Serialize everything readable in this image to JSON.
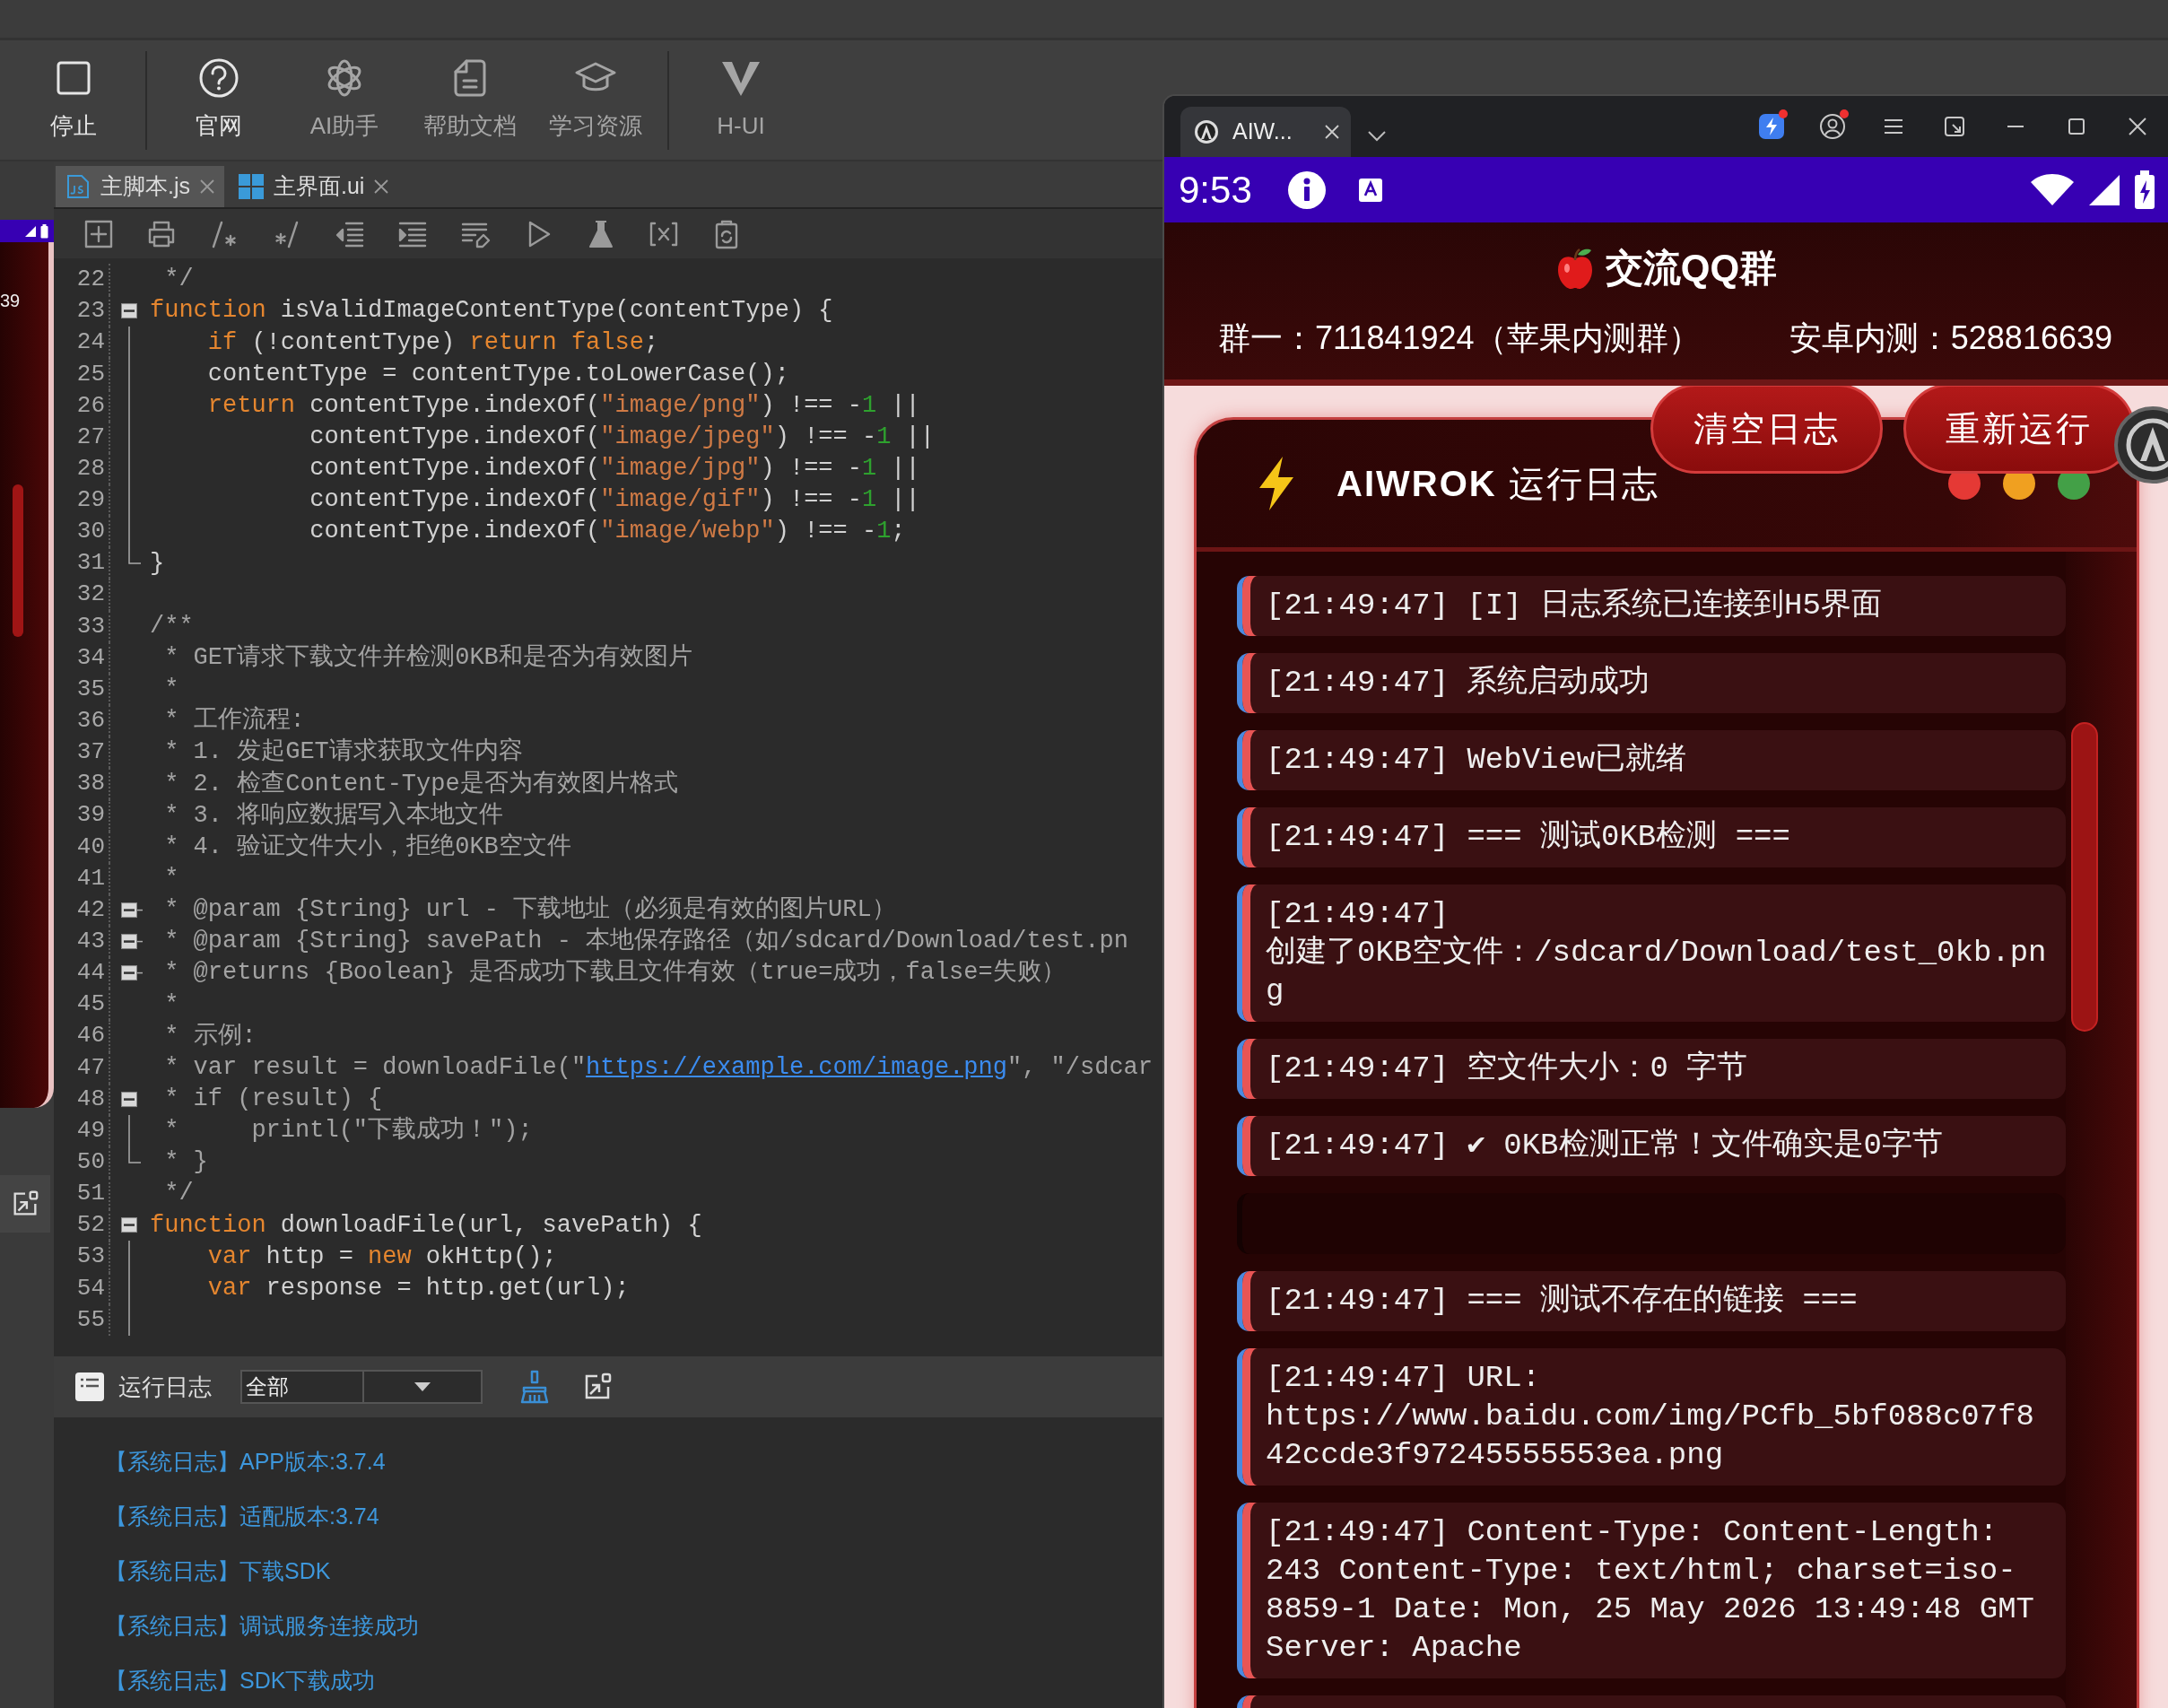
{
  "toolbar": [
    {
      "kind": "stop",
      "label": "停止",
      "disabled": false
    },
    {
      "kind": "separator"
    },
    {
      "kind": "website",
      "label": "官网",
      "disabled": false
    },
    {
      "kind": "assistant",
      "label": "AI助手",
      "disabled": true
    },
    {
      "kind": "docs",
      "label": "帮助文档",
      "disabled": true
    },
    {
      "kind": "learning",
      "label": "学习资源",
      "disabled": true
    },
    {
      "kind": "separator"
    },
    {
      "kind": "ui",
      "label": "H-UI",
      "disabled": true
    }
  ],
  "preview_strip": {
    "text": "39"
  },
  "editor": {
    "tabs": [
      {
        "kind": "js",
        "label": "主脚本.js",
        "selected": true
      },
      {
        "kind": "ui",
        "label": "主界面.ui",
        "selected": false
      }
    ],
    "lines": [
      {
        "number": "22",
        "tokens": [
          {
            "kind": "comment",
            "text": " */"
          }
        ]
      },
      {
        "number": "23",
        "kind": "open",
        "tokens": [
          {
            "kind": "keyword",
            "text": "function"
          },
          {
            "kind": "plain",
            "text": " isValidImageContentType(contentType) {"
          }
        ]
      },
      {
        "number": "24",
        "kind": "line",
        "tokens": [
          {
            "kind": "keyword",
            "text": "    if"
          },
          {
            "kind": "plain",
            "text": " (!contentType) "
          },
          {
            "kind": "keyword",
            "text": "return false"
          },
          {
            "kind": "plain",
            "text": ";"
          }
        ]
      },
      {
        "number": "25",
        "kind": "line",
        "tokens": [
          {
            "kind": "plain",
            "text": "    contentType = contentType.toLowerCase();"
          }
        ]
      },
      {
        "number": "26",
        "kind": "line",
        "tokens": [
          {
            "kind": "keyword",
            "text": "    return"
          },
          {
            "kind": "plain",
            "text": " contentType.indexOf("
          },
          {
            "kind": "string",
            "text": "\"image/png\""
          },
          {
            "kind": "plain",
            "text": ") !== -"
          },
          {
            "kind": "number",
            "text": "1"
          },
          {
            "kind": "plain",
            "text": " ||"
          }
        ]
      },
      {
        "number": "27",
        "kind": "line",
        "tokens": [
          {
            "kind": "plain",
            "text": "           contentType.indexOf("
          },
          {
            "kind": "string",
            "text": "\"image/jpeg\""
          },
          {
            "kind": "plain",
            "text": ") !== -"
          },
          {
            "kind": "number",
            "text": "1"
          },
          {
            "kind": "plain",
            "text": " ||"
          }
        ]
      },
      {
        "number": "28",
        "kind": "line",
        "tokens": [
          {
            "kind": "plain",
            "text": "           contentType.indexOf("
          },
          {
            "kind": "string",
            "text": "\"image/jpg\""
          },
          {
            "kind": "plain",
            "text": ") !== -"
          },
          {
            "kind": "number",
            "text": "1"
          },
          {
            "kind": "plain",
            "text": " ||"
          }
        ]
      },
      {
        "number": "29",
        "kind": "line",
        "tokens": [
          {
            "kind": "plain",
            "text": "           contentType.indexOf("
          },
          {
            "kind": "string",
            "text": "\"image/gif\""
          },
          {
            "kind": "plain",
            "text": ") !== -"
          },
          {
            "kind": "number",
            "text": "1"
          },
          {
            "kind": "plain",
            "text": " ||"
          }
        ]
      },
      {
        "number": "30",
        "kind": "line",
        "tokens": [
          {
            "kind": "plain",
            "text": "           contentType.indexOf("
          },
          {
            "kind": "string",
            "text": "\"image/webp\""
          },
          {
            "kind": "plain",
            "text": ") !== -"
          },
          {
            "kind": "number",
            "text": "1"
          },
          {
            "kind": "plain",
            "text": ";"
          }
        ]
      },
      {
        "number": "31",
        "kind": "end",
        "tokens": [
          {
            "kind": "plain",
            "text": "}"
          }
        ]
      },
      {
        "number": "32"
      },
      {
        "number": "33",
        "tokens": [
          {
            "kind": "comment",
            "text": "/**"
          }
        ]
      },
      {
        "number": "34",
        "tokens": [
          {
            "kind": "comment",
            "text": " * GET请求下载文件并检测0KB和是否为有效图片"
          }
        ]
      },
      {
        "number": "35",
        "tokens": [
          {
            "kind": "comment",
            "text": " *"
          }
        ]
      },
      {
        "number": "36",
        "tokens": [
          {
            "kind": "comment",
            "text": " * 工作流程:"
          }
        ]
      },
      {
        "number": "37",
        "tokens": [
          {
            "kind": "comment",
            "text": " * 1. 发起GET请求获取文件内容"
          }
        ]
      },
      {
        "number": "38",
        "tokens": [
          {
            "kind": "comment",
            "text": " * 2. 检查Content-Type是否为有效图片格式"
          }
        ]
      },
      {
        "number": "39",
        "tokens": [
          {
            "kind": "comment",
            "text": " * 3. 将响应数据写入本地文件"
          }
        ]
      },
      {
        "number": "40",
        "tokens": [
          {
            "kind": "comment",
            "text": " * 4. 验证文件大小，拒绝0KB空文件"
          }
        ]
      },
      {
        "number": "41",
        "tokens": [
          {
            "kind": "comment",
            "text": " *"
          }
        ]
      },
      {
        "number": "42",
        "kind": "open-dash",
        "tokens": [
          {
            "kind": "comment",
            "text": " * @param {String} url - 下载地址（必须是有效的图片URL）"
          }
        ]
      },
      {
        "number": "43",
        "kind": "open-dash",
        "tokens": [
          {
            "kind": "comment",
            "text": " * @param {String} savePath - 本地保存路径（如/sdcard/Download/test.pn"
          }
        ]
      },
      {
        "number": "44",
        "kind": "open-dash",
        "tokens": [
          {
            "kind": "comment",
            "text": " * @returns {Boolean} 是否成功下载且文件有效（true=成功，false=失败）"
          }
        ]
      },
      {
        "number": "45",
        "tokens": [
          {
            "kind": "comment",
            "text": " *"
          }
        ]
      },
      {
        "number": "46",
        "tokens": [
          {
            "kind": "comment",
            "text": " * 示例:"
          }
        ]
      },
      {
        "number": "47",
        "tokens": [
          {
            "kind": "comment",
            "text": " * var result = downloadFile(\""
          },
          {
            "kind": "link",
            "text": "https://example.com/image.png"
          },
          {
            "kind": "comment",
            "text": "\", \"/sdcar"
          }
        ]
      },
      {
        "number": "48",
        "kind": "open",
        "tokens": [
          {
            "kind": "comment",
            "text": " * if (result) {"
          }
        ]
      },
      {
        "number": "49",
        "kind": "line",
        "tokens": [
          {
            "kind": "comment",
            "text": " *     printl(\"下载成功！\");"
          }
        ]
      },
      {
        "number": "50",
        "kind": "end",
        "tokens": [
          {
            "kind": "comment",
            "text": " * }"
          }
        ]
      },
      {
        "number": "51",
        "tokens": [
          {
            "kind": "comment",
            "text": " */"
          }
        ]
      },
      {
        "number": "52",
        "kind": "open",
        "tokens": [
          {
            "kind": "keyword",
            "text": "function"
          },
          {
            "kind": "plain",
            "text": " downloadFile(url, savePath) {"
          }
        ]
      },
      {
        "number": "53",
        "kind": "line",
        "tokens": [
          {
            "kind": "keyword",
            "text": "    var"
          },
          {
            "kind": "plain",
            "text": " http = "
          },
          {
            "kind": "keyword",
            "text": "new"
          },
          {
            "kind": "plain",
            "text": " okHttp();"
          }
        ]
      },
      {
        "number": "54",
        "kind": "line",
        "tokens": [
          {
            "kind": "keyword",
            "text": "    var"
          },
          {
            "kind": "plain",
            "text": " response = http.get(url);"
          }
        ]
      },
      {
        "number": "55",
        "kind": "line"
      }
    ]
  },
  "run_log": {
    "title": "运行日志",
    "filter": "全部",
    "entries": [
      "【系统日志】APP版本:3.7.4",
      "【系统日志】适配版本:3.74",
      "【系统日志】下载SDK",
      "【系统日志】调试服务连接成功",
      "【系统日志】SDK下载成功"
    ]
  },
  "phone_window": {
    "tab_title": "AIW...",
    "icons": [
      {
        "kind": "bolt",
        "badge": true
      },
      {
        "kind": "account",
        "badge": true
      },
      {
        "kind": "menu",
        "badge": false
      },
      {
        "kind": "snap",
        "badge": false
      }
    ]
  },
  "status_bar": {
    "time": "9:53"
  },
  "group_info": {
    "title": "交流QQ群",
    "groups": [
      "群一：711841924（苹果内测群）",
      "安卓内测：528816639"
    ]
  },
  "actions": [
    "清空日志",
    "重新运行"
  ],
  "log_card": {
    "title": "**AIWROK** 运行日志",
    "dots": [
      {
        "color": "#e53935"
      },
      {
        "color": "#f0a020"
      },
      {
        "color": "#43a047"
      }
    ],
    "entries": [
      {
        "kind": "entry",
        "text": "[21:49:47] [I] 日志系统已连接到H5界面"
      },
      {
        "kind": "entry",
        "text": "[21:49:47] 系统启动成功"
      },
      {
        "kind": "entry",
        "text": "[21:49:47] WebView已就绪"
      },
      {
        "kind": "entry",
        "text": "[21:49:47] === 测试0KB检测 ==="
      },
      {
        "kind": "entry",
        "text": "[21:49:47] 创建了0KB空文件：/sdcard/Download/test_0kb.png"
      },
      {
        "kind": "entry",
        "text": "[21:49:47] 空文件大小：0 字节"
      },
      {
        "kind": "entry",
        "text": "[21:49:47] ✔ 0KB检测正常！文件确实是0字节"
      },
      {
        "kind": "empty"
      },
      {
        "kind": "entry",
        "text": "[21:49:47] === 测试不存在的链接 ==="
      },
      {
        "kind": "entry",
        "text": "[21:49:47] URL: https://www.baidu.com/img/PCfb_5bf088c07f842ccde3f97245555553ea.png"
      },
      {
        "kind": "entry",
        "text": "[21:49:47] Content-Type: Content-Length: 243 Content-Type: text/html; charset=iso-8859-1 Date: Mon, 25 May 2026 13:49:48 GMT Server: Apache"
      },
      {
        "kind": "cut"
      }
    ]
  }
}
